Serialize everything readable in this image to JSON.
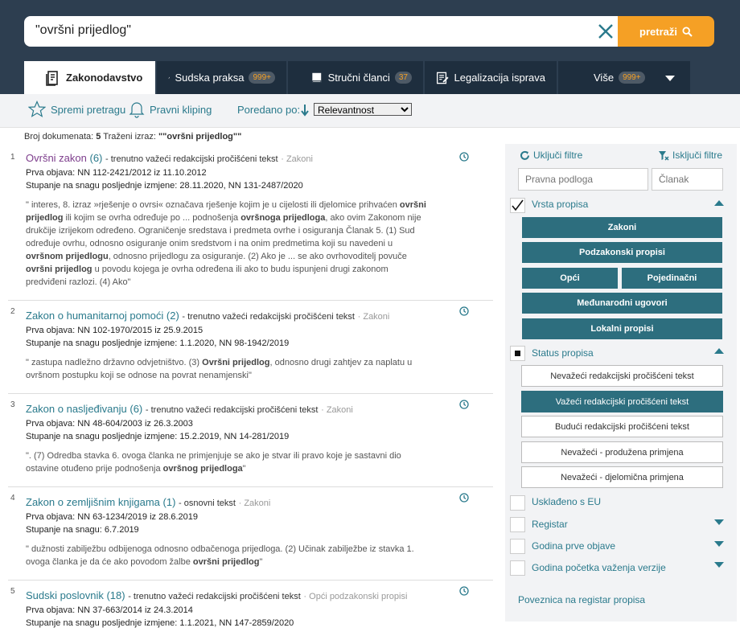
{
  "search": {
    "query": "\"ovršni prijedlog\"",
    "button_label": "pretraži"
  },
  "tabs": [
    {
      "label": "Zakonodavstvo",
      "badge": ""
    },
    {
      "label": "Sudska praksa",
      "badge": "999+"
    },
    {
      "label": "Stručni članci",
      "badge": "37"
    },
    {
      "label": "Legalizacija isprava",
      "badge": ""
    },
    {
      "label": "Više",
      "badge": "999+"
    }
  ],
  "toolbar": {
    "save_search": "Spremi pretragu",
    "legal_clipping": "Pravni kliping",
    "order_label": "Poredano po:",
    "order_value": "Relevantnost"
  },
  "summary": {
    "count_label": "Broj dokumenata:",
    "count": "5",
    "term_label": "Traženi izraz:",
    "term": "\"\"ovršni prijedlog\"\""
  },
  "results": [
    {
      "num": "1",
      "title": "Ovršni zakon",
      "count": "(6)",
      "status": "- trenutno važeći redakcijski pročišćeni tekst",
      "category": "· Zakoni",
      "first_pub": "Prva objava: NN 112-2421/2012 iz 11.10.2012",
      "effective": "Stupanje na snagu posljednje izmjene: 28.11.2020, NN 131-2487/2020",
      "snippet": [
        {
          "t": "\" interes, 8. izraz »rješenje o ovrsi« označava rješenje kojim je u cijelosti ili djelomice prihvaćen ",
          "b": false
        },
        {
          "t": "ovršni prijedlog",
          "b": true
        },
        {
          "t": " ili kojim se ovrha određuje po ... podnošenja ",
          "b": false
        },
        {
          "t": "ovršnoga prijedloga",
          "b": true
        },
        {
          "t": ", ako ovim Zakonom nije drukčije izrijekom određeno. Ograničenje sredstava i predmeta ovrhe i osiguranja Članak 5. (1) Sud određuje ovrhu, odnosno osiguranje onim sredstvom i na onim predmetima koji su navedeni u ",
          "b": false
        },
        {
          "t": "ovršnom prijedlogu",
          "b": true
        },
        {
          "t": ", odnosno prijedlogu za osiguranje. (2) Ako je ... se ako ovrhovoditelj povuče ",
          "b": false
        },
        {
          "t": "ovršni prijedlog",
          "b": true
        },
        {
          "t": " u povodu kojega je ovrha određena ili ako to budu ispunjeni drugi zakonom predviđeni razlozi. (4) Ako\"",
          "b": false
        }
      ]
    },
    {
      "num": "2",
      "title": "Zakon o humanitarnoj pomoći",
      "count": "(2)",
      "status": "- trenutno važeći redakcijski pročišćeni tekst",
      "category": "· Zakoni",
      "first_pub": "Prva objava: NN 102-1970/2015 iz 25.9.2015",
      "effective": "Stupanje na snagu posljednje izmjene: 1.1.2020, NN 98-1942/2019",
      "snippet": [
        {
          "t": "\" zastupa nadležno državno odvjetništvo. (3) ",
          "b": false
        },
        {
          "t": "Ovršni prijedlog",
          "b": true
        },
        {
          "t": ", odnosno drugi zahtjev za naplatu u ovršnom postupku koji se odnose na povrat nenamjenski\"",
          "b": false
        }
      ]
    },
    {
      "num": "3",
      "title": "Zakon o nasljeđivanju",
      "count": "(6)",
      "status": "- trenutno važeći redakcijski pročišćeni tekst",
      "category": "· Zakoni",
      "first_pub": "Prva objava: NN 48-604/2003 iz 26.3.2003",
      "effective": "Stupanje na snagu posljednje izmjene: 15.2.2019, NN 14-281/2019",
      "snippet": [
        {
          "t": "\". (7) Odredba stavka 6. ovoga članka ne primjenjuje se ako je stvar ili pravo koje je sastavni dio ostavine otuđeno prije podnošenja ",
          "b": false
        },
        {
          "t": "ovršnog prijedloga",
          "b": true
        },
        {
          "t": "\"",
          "b": false
        }
      ]
    },
    {
      "num": "4",
      "title": "Zakon o zemljišnim knjigama",
      "count": "(1)",
      "status": "- osnovni tekst",
      "category": "· Zakoni",
      "first_pub": "Prva objava: NN 63-1234/2019 iz 28.6.2019",
      "effective": "Stupanje na snagu: 6.7.2019",
      "snippet": [
        {
          "t": "\" dužnosti zabilježbu odbijenoga odnosno odbačenoga prijedloga. (2) Učinak zabilježbe iz stavka 1. ovoga članka je da će ako povodom žalbe ",
          "b": false
        },
        {
          "t": "ovršni prijedlog",
          "b": true
        },
        {
          "t": "\"",
          "b": false
        }
      ]
    },
    {
      "num": "5",
      "title": "Sudski poslovnik",
      "count": "(18)",
      "status": "- trenutno važeći redakcijski pročišćeni tekst",
      "category": "· Opći podzakonski propisi",
      "first_pub": "Prva objava: NN 37-663/2014 iz 24.3.2014",
      "effective": "Stupanje na snagu posljednje izmjene: 1.1.2021, NN 147-2859/2020",
      "snippet": []
    }
  ],
  "sidebar": {
    "include_filters": "Uključi filtre",
    "exclude_filters": "Isključi filtre",
    "legal_basis_placeholder": "Pravna podloga",
    "article_placeholder": "Članak",
    "type_label": "Vrsta propisa",
    "type_buttons": [
      "Zakoni",
      "Podzakonski propisi",
      "Opći",
      "Pojedinačni",
      "Međunarodni ugovori",
      "Lokalni propisi"
    ],
    "status_label": "Status propisa",
    "status_buttons": [
      "Nevažeći redakcijski pročišćeni tekst",
      "Važeći redakcijski pročišćeni tekst",
      "Budući redakcijski pročišćeni tekst",
      "Nevažeći - produžena primjena",
      "Nevažeći - djelomična primjena"
    ],
    "eu_label": "Usklađeno s EU",
    "register_label": "Registar",
    "first_pub_year_label": "Godina prve objave",
    "version_year_label": "Godina početka važenja verzije",
    "register_link": "Poveznica na registar propisa"
  }
}
